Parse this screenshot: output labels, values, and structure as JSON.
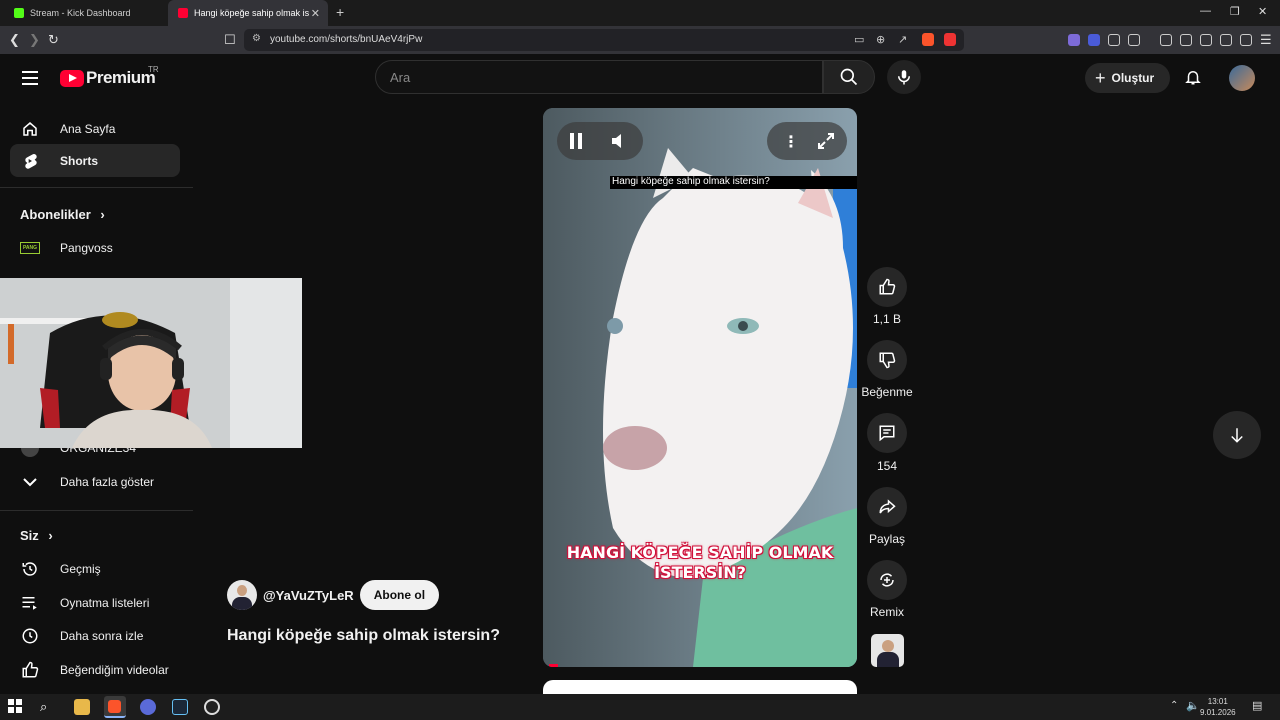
{
  "browser": {
    "tabs": [
      {
        "title": "Stream - Kick Dashboard",
        "active": false
      },
      {
        "title": "Hangi köpeğe sahip olmak is",
        "active": true
      }
    ],
    "url": "youtube.com/shorts/bnUAeV4rjPw"
  },
  "youtube": {
    "logo_text": "Premium",
    "country_code": "TR",
    "search_placeholder": "Ara",
    "create_label": "Oluştur",
    "sidebar": {
      "main": [
        {
          "label": "Ana Sayfa",
          "icon": "home-icon"
        },
        {
          "label": "Shorts",
          "icon": "shorts-icon",
          "active": true
        }
      ],
      "subscriptions_title": "Abonelikler",
      "subscriptions": [
        {
          "label": "Pangvoss"
        },
        {
          "label": "ORGANIZE34"
        }
      ],
      "show_more": "Daha fazla göster",
      "you_title": "Siz",
      "you": [
        {
          "label": "Geçmiş",
          "icon": "history-icon"
        },
        {
          "label": "Oynatma listeleri",
          "icon": "playlist-icon"
        },
        {
          "label": "Daha sonra izle",
          "icon": "clock-icon"
        },
        {
          "label": "Beğendiğim videolar",
          "icon": "thumbs-up-icon"
        }
      ]
    },
    "short": {
      "overlay_title": "Hangi köpeğe sahip olmak istersin?",
      "caption_line1": "HANGİ KÖPEĞE SAHİP OLMAK",
      "caption_line2": "İSTERSİN?",
      "channel": "@YaVuZTyLeR",
      "subscribe_label": "Abone ol",
      "title": "Hangi köpeğe sahip olmak istersin?",
      "likes": "1,1 B",
      "dislike_label": "Beğenme",
      "comments": "154",
      "share_label": "Paylaş",
      "remix_label": "Remix"
    }
  },
  "taskbar": {
    "time": "13:01",
    "date": "9.01.2026"
  }
}
